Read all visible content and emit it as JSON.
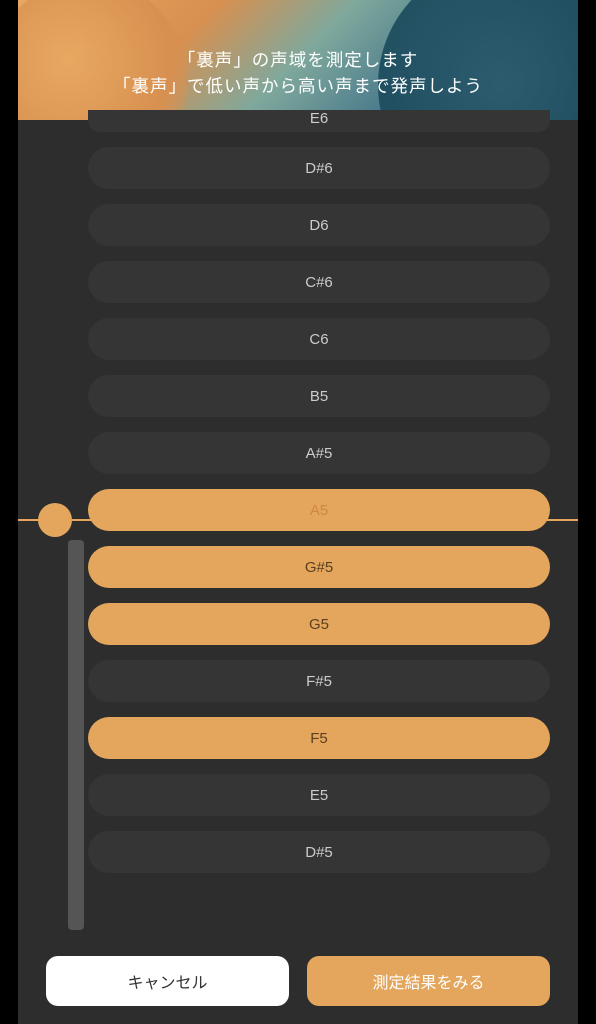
{
  "header": {
    "line1": "「裏声」の声域を測定します",
    "line2": "「裏声」で低い声から高い声まで発声しよう"
  },
  "notes": [
    {
      "label": "E6",
      "highlighted": false,
      "partial": "top"
    },
    {
      "label": "D#6",
      "highlighted": false
    },
    {
      "label": "D6",
      "highlighted": false
    },
    {
      "label": "C#6",
      "highlighted": false
    },
    {
      "label": "C6",
      "highlighted": false
    },
    {
      "label": "B5",
      "highlighted": false
    },
    {
      "label": "A#5",
      "highlighted": false
    },
    {
      "label": "A5",
      "highlighted": true,
      "cursor": true
    },
    {
      "label": "G#5",
      "highlighted": true
    },
    {
      "label": "G5",
      "highlighted": true
    },
    {
      "label": "F#5",
      "highlighted": false
    },
    {
      "label": "F5",
      "highlighted": true
    },
    {
      "label": "E5",
      "highlighted": false
    },
    {
      "label": "D#5",
      "highlighted": false
    }
  ],
  "footer": {
    "cancel_label": "キャンセル",
    "result_label": "測定結果をみる"
  },
  "colors": {
    "highlight": "#e3a65c",
    "bg": "#2d2d2d",
    "row_bg": "#353535"
  }
}
